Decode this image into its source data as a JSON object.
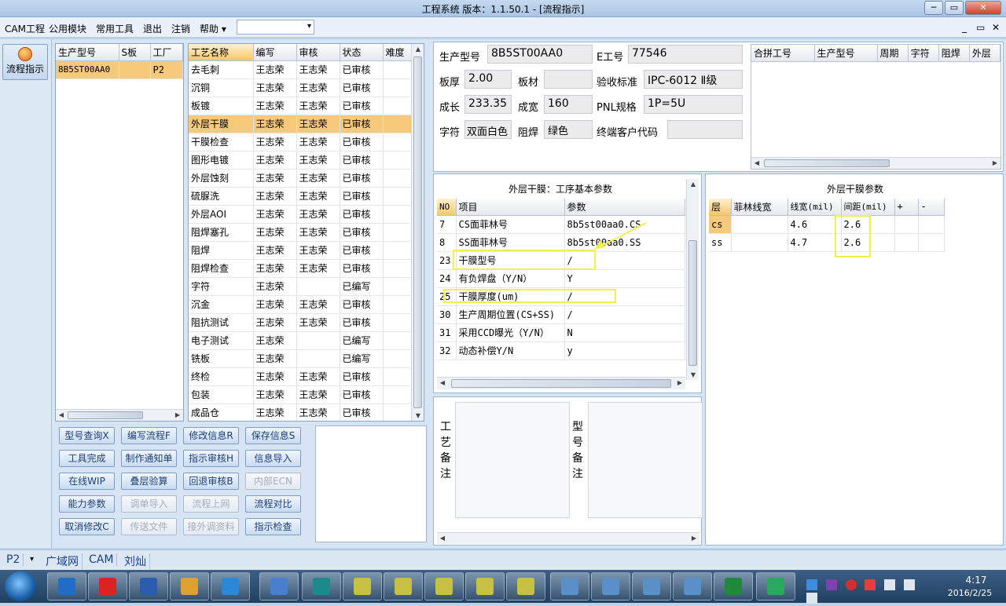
{
  "window": {
    "title": "工程系统   版本：1.1.50.1 - [流程指示]",
    "min": "─",
    "restore": "▭",
    "close": "✕"
  },
  "menubar": {
    "items": [
      "CAM工程",
      "公用模块",
      "常用工具",
      "退出",
      "注销",
      "帮助 ▾"
    ],
    "combo_value": "",
    "combo_arrow": "▾",
    "mdi_controls": [
      "_",
      "▭",
      "✕"
    ]
  },
  "leftnav": {
    "flow_label": "流程指示"
  },
  "models": {
    "headers": [
      "生产型号",
      "S板",
      "工厂"
    ],
    "rows": [
      [
        "8B5ST00AA0",
        "",
        "P2"
      ]
    ]
  },
  "process": {
    "headers": [
      "工艺名称",
      "编写",
      "审核",
      "状态",
      "难度"
    ],
    "rows": [
      [
        "去毛刺",
        "王志荣",
        "王志荣",
        "已审核",
        ""
      ],
      [
        "沉铜",
        "王志荣",
        "王志荣",
        "已审核",
        ""
      ],
      [
        "板镀",
        "王志荣",
        "王志荣",
        "已审核",
        ""
      ],
      [
        "外层干膜",
        "王志荣",
        "王志荣",
        "已审核",
        ""
      ],
      [
        "干膜检查",
        "王志荣",
        "王志荣",
        "已审核",
        ""
      ],
      [
        "图形电镀",
        "王志荣",
        "王志荣",
        "已审核",
        ""
      ],
      [
        "外层蚀刻",
        "王志荣",
        "王志荣",
        "已审核",
        ""
      ],
      [
        "硫脲洗",
        "王志荣",
        "王志荣",
        "已审核",
        ""
      ],
      [
        "外层AOI",
        "王志荣",
        "王志荣",
        "已审核",
        ""
      ],
      [
        "阻焊塞孔",
        "王志荣",
        "王志荣",
        "已审核",
        ""
      ],
      [
        "阻焊",
        "王志荣",
        "王志荣",
        "已审核",
        ""
      ],
      [
        "阻焊检查",
        "王志荣",
        "王志荣",
        "已审核",
        ""
      ],
      [
        "字符",
        "王志荣",
        "",
        "已编写",
        ""
      ],
      [
        "沉金",
        "王志荣",
        "王志荣",
        "已审核",
        ""
      ],
      [
        "阻抗测试",
        "王志荣",
        "王志荣",
        "已审核",
        ""
      ],
      [
        "电子测试",
        "王志荣",
        "",
        "已编写",
        ""
      ],
      [
        "铣板",
        "王志荣",
        "",
        "已编写",
        ""
      ],
      [
        "终检",
        "王志荣",
        "王志荣",
        "已审核",
        ""
      ],
      [
        "包装",
        "王志荣",
        "王志荣",
        "已审核",
        ""
      ],
      [
        "成品仓",
        "王志荣",
        "王志荣",
        "已审核",
        ""
      ]
    ]
  },
  "buttons": [
    [
      "型号查询X",
      "编写流程F",
      "修改信息R",
      "保存信息S"
    ],
    [
      "工具完成",
      "制作通知单",
      "指示审核H",
      "信息导入"
    ],
    [
      "在线WIP",
      "叠层验算",
      "回退审核B",
      "内部ECN"
    ],
    [
      "能力参数",
      "调单导入",
      "流程上网",
      "流程对比"
    ],
    [
      "取消修改C",
      "传送文件",
      "接外调资料",
      "指示检查"
    ]
  ],
  "info": {
    "model_label": "生产型号",
    "model": "8B5ST00AA0",
    "e_label": "E工号",
    "e_no": "77546",
    "thick_label": "板厚",
    "thick": "2.00",
    "material_label": "板材",
    "material": "",
    "std_label": "验收标准",
    "std": "IPC-6012 Ⅱ级",
    "len_label": "成长",
    "len": "233.35",
    "wid_label": "成宽",
    "wid": "160",
    "pnl_label": "PNL规格",
    "pnl": "1P=5U",
    "char_label": "字符",
    "char": "双面白色",
    "mask_label": "阻焊",
    "mask": "绿色",
    "cust_label": "终端客户代码",
    "cust": ""
  },
  "combine": {
    "headers": [
      "合拼工号",
      "生产型号",
      "周期",
      "字符",
      "阻焊",
      "外层"
    ]
  },
  "basic": {
    "title": "外层干膜：工序基本参数",
    "headers": [
      "NO",
      "项目",
      "参数"
    ],
    "rows": [
      [
        "7",
        "CS面菲林号",
        "8b5st00aa0.CS"
      ],
      [
        "8",
        "SS面菲林号",
        "8b5st00aa0.SS"
      ],
      [
        "23",
        "干膜型号",
        "/"
      ],
      [
        "24",
        "有负焊盘（Y/N）",
        "Y"
      ],
      [
        "25",
        "干膜厚度(um)",
        "/"
      ],
      [
        "30",
        "生产周期位置(CS+SS)",
        "/"
      ],
      [
        "31",
        "采用CCD曝光（Y/N）",
        "N"
      ],
      [
        "32",
        "动态补偿Y/N",
        "y"
      ]
    ]
  },
  "film": {
    "title": "外层干膜参数",
    "headers": [
      "层",
      "菲林线宽",
      "线宽(mil)",
      "间距(mil)",
      "+",
      "-"
    ],
    "rows": [
      [
        "cs",
        "",
        "4.6",
        "2.6",
        "",
        ""
      ],
      [
        "ss",
        "",
        "4.7",
        "2.6",
        "",
        ""
      ]
    ]
  },
  "notes": {
    "craft_label": "工艺备注",
    "model_label": "型号备注"
  },
  "status": {
    "items": [
      "P2",
      "广域网",
      "CAM",
      "刘灿"
    ],
    "dropdown": "▾"
  },
  "taskbar": {
    "time": "4:17",
    "date": "2016/2/25"
  }
}
